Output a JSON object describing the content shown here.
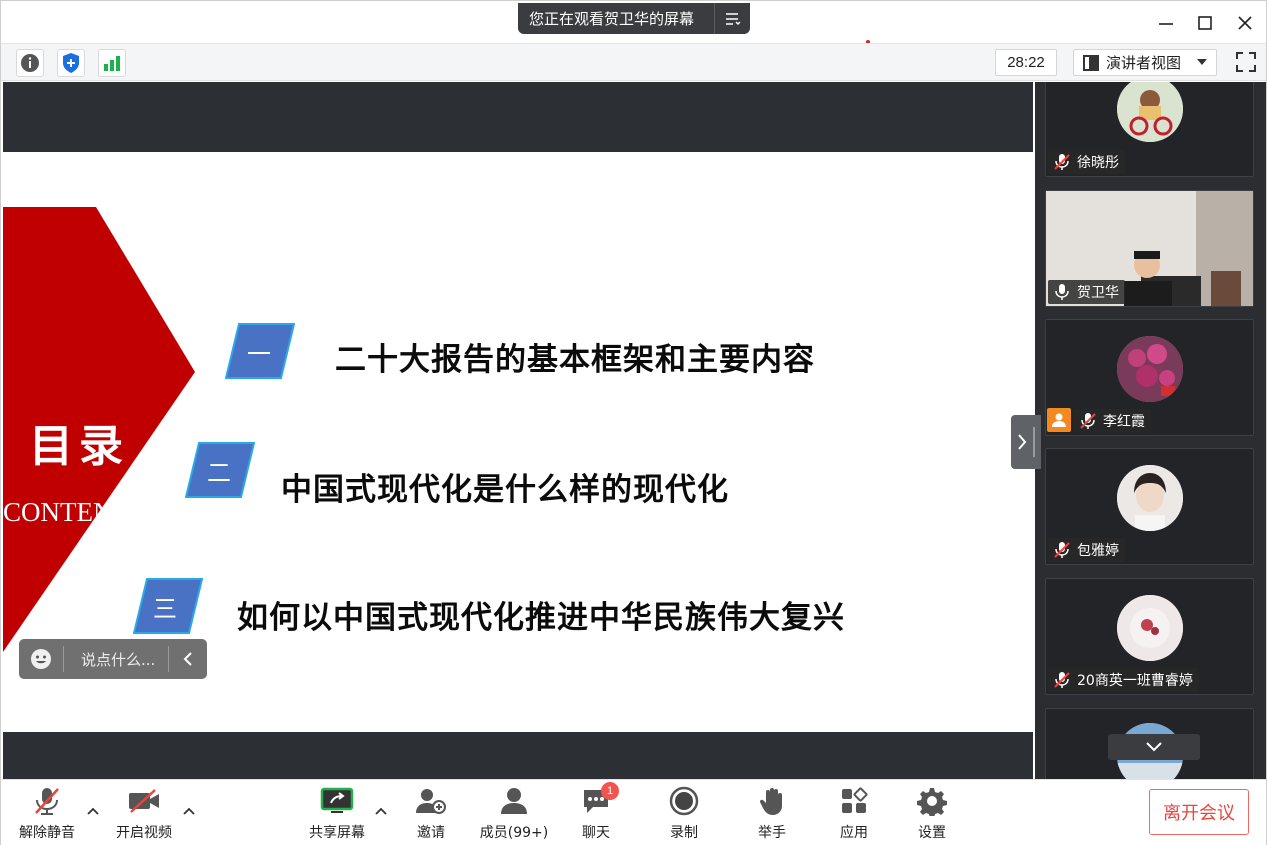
{
  "titlebar": {
    "share_banner": "您正在观看贺卫华的屏幕",
    "minimize": "—",
    "maximize": "☐",
    "close": "✕"
  },
  "subbar": {
    "timer": "28:22",
    "view_mode": "演讲者视图"
  },
  "slide": {
    "heading": "目录",
    "heading_en": "CONTENTS",
    "items": [
      {
        "num": "一",
        "text": "二十大报告的基本框架和主要内容"
      },
      {
        "num": "二",
        "text": "中国式现代化是什么样的现代化"
      },
      {
        "num": "三",
        "text": "如何以中国式现代化推进中华民族伟大复兴"
      }
    ],
    "colors": {
      "red": "#c00000",
      "box": "#4a72c4",
      "box_border": "#2aa9e8"
    }
  },
  "chat": {
    "placeholder": "说点什么..."
  },
  "participants": [
    {
      "name": "徐晓彤",
      "mic": "muted",
      "avatar": "cartoon-avatar"
    },
    {
      "name": "贺卫华",
      "mic": "on",
      "avatar": "video"
    },
    {
      "name": "李红霞",
      "mic": "muted",
      "avatar": "flower-avatar",
      "host": true
    },
    {
      "name": "包雅婷",
      "mic": "muted",
      "avatar": "person-avatar"
    },
    {
      "name": "20商英一班曹睿婷",
      "mic": "muted",
      "avatar": "flower-avatar"
    }
  ],
  "toolbar": {
    "unmute": "解除静音",
    "start_video": "开启视频",
    "share_screen": "共享屏幕",
    "invite": "邀请",
    "members": "成员(99+)",
    "chat": "聊天",
    "chat_badge": "1",
    "record": "录制",
    "raise_hand": "举手",
    "apps": "应用",
    "settings": "设置",
    "leave": "离开会议"
  }
}
